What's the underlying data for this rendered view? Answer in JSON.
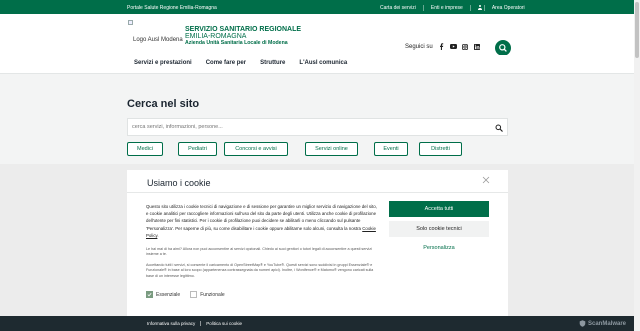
{
  "topbar": {
    "portal": "Portale Salute Regione Emilia-Romagna",
    "links": [
      "Carta dei servizi",
      "Enti e imprese"
    ],
    "operator_area": "Area Operatori"
  },
  "header": {
    "logo_alt": "Logo Ausl Modena",
    "brand_line1": "SERVIZIO SANITARIO REGIONALE",
    "brand_line2": "EMILIA-ROMAGNA",
    "brand_line3": "Azienda Unità Sanitaria Locale di Modena",
    "social_label": "Seguici su",
    "social_icons": [
      "facebook-icon",
      "youtube-icon",
      "instagram-icon",
      "linkedin-icon"
    ]
  },
  "nav": {
    "items": [
      "Servizi e prestazioni",
      "Come fare per",
      "Strutture",
      "L'Ausl comunica"
    ]
  },
  "main": {
    "title": "Cerca nel sito",
    "search_placeholder": "cerca servizi, informazioni, persone...",
    "quick_links": [
      "Medici",
      "Pediatri",
      "Concorsi e avvisi",
      "Servizi online",
      "Eventi",
      "Distretti"
    ]
  },
  "cookie": {
    "title": "Usiamo i cookie",
    "text_main": "Questo sito utilizza i cookie tecnici di navigazione e di sessione per garantire un miglior servizio di navigazione del sito, e cookie analitici per raccogliere informazioni sull'uso del sito da parte degli utenti. Utilizza anche cookie di profilazione dell'utente per fini statistici. Per i cookie di profilazione puoi decidere se abilitarli o meno cliccando sul pulsante 'Personalizza'. Per saperne di più, su come disabilitare i cookie oppure abilitarne solo alcuni, consulta la nostra",
    "policy_link": "Cookie Policy",
    "note1": "Le hai mai di ha aimi? Allora non puoi acconsentire ai servizi opzionali. Chiedo ai suoi genitori o tutori legali di acconsentire a questi servizi insieme a te.",
    "note2": "Accettando tutti i servizi, si consente il caricamento di OpenStreetMap® e YouTube®. Questi servizi sono suddivisi in gruppi Essenziale® e Funzionale® in base al loro scopo (appartenenza contrassegnata da numeri apici). Inoltre, i Wordfence® e Matomo® vengono caricati sulla base di un interesse legittimo.",
    "check_essential": "Essenziale",
    "check_functional": "Funzionale",
    "btn_accept_all": "Accetta tutti",
    "btn_technical": "Solo cookie tecnici",
    "btn_customize": "Personalizza"
  },
  "footer": {
    "links": [
      "Informativa sulla privacy",
      "Politica sui cookie"
    ],
    "watermark": "ScanMalware"
  },
  "colors": {
    "brand_green": "#006e49",
    "footer_dark": "#1e2a30"
  }
}
